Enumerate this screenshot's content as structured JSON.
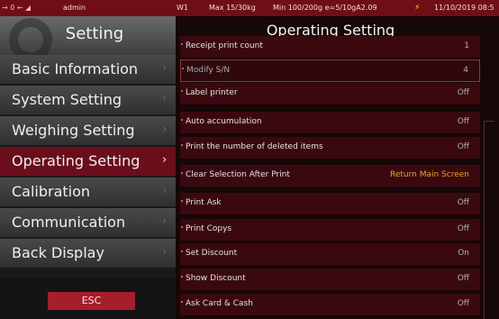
{
  "status_bar": {
    "indicators": "→ 0 ←",
    "user": "admin",
    "scale": "W1",
    "max": "Max 15/30kg",
    "min": "Min 100/200g e=5/10g",
    "version": "A2.09",
    "power_icon": "lightning-icon",
    "date": "11/10/2019 08:5"
  },
  "left_panel": {
    "title": "Setting",
    "menu": [
      {
        "label": "Basic Information"
      },
      {
        "label": "System Setting"
      },
      {
        "label": "Weighing Setting"
      },
      {
        "label": "Operating Setting",
        "active": true
      },
      {
        "label": "Calibration"
      },
      {
        "label": "Communication"
      },
      {
        "label": "Back Display"
      }
    ],
    "esc_label": "ESC"
  },
  "right_panel": {
    "title": "Operating Setting",
    "rows": [
      {
        "label": "Receipt print count",
        "value": "1"
      },
      {
        "label": "Modify S/N",
        "value": "4"
      },
      {
        "label": "Label printer",
        "value": "Off"
      },
      {
        "label": "Auto accumulation",
        "value": "Off"
      },
      {
        "label": "Print the number of deleted items",
        "value": "Off"
      },
      {
        "label": "Clear Selection After Print",
        "value": "Return Main Screen"
      },
      {
        "label": "Print Ask",
        "value": "Off"
      },
      {
        "label": "Print Copys",
        "value": "Off"
      },
      {
        "label": "Set Discount",
        "value": "On"
      },
      {
        "label": "Show Discount",
        "value": "Off"
      },
      {
        "label": "Ask Card & Cash",
        "value": "Off"
      }
    ]
  },
  "colors": {
    "active_menu": "#6b0e1c",
    "row_bg": "#3a090f",
    "esc_button": "#a61d2c",
    "status_bar": "#700e16",
    "highlight_value": "#e8a030"
  }
}
